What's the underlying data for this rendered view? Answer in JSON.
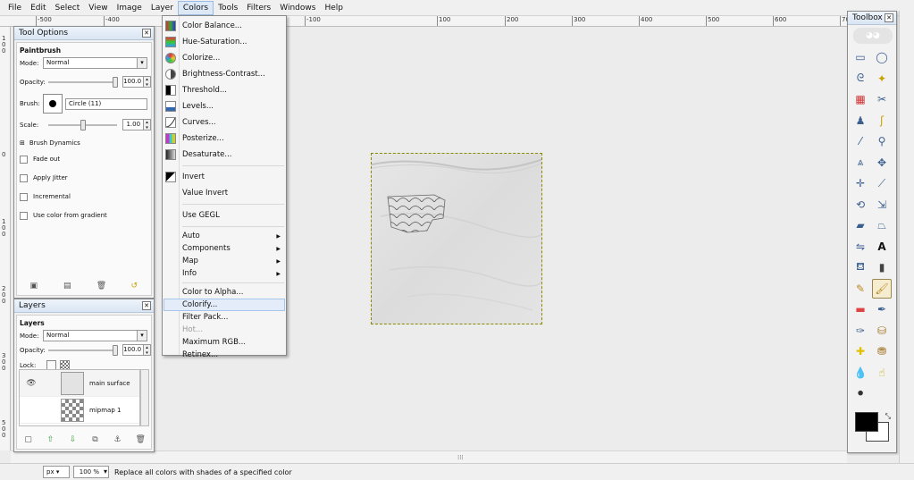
{
  "menubar": {
    "items": [
      "File",
      "Edit",
      "Select",
      "View",
      "Image",
      "Layer",
      "Colors",
      "Tools",
      "Filters",
      "Windows",
      "Help"
    ]
  },
  "ruler": {
    "h_labels": [
      "-500",
      "-400",
      "-100",
      "100",
      "200",
      "300",
      "400",
      "500",
      "600",
      "700"
    ],
    "v_labels": [
      "1 0 0",
      "0",
      "1 0 0",
      "2 0 0",
      "3 0 0",
      "5 0 0"
    ]
  },
  "colors_menu": {
    "items": [
      {
        "label": "Color Balance...",
        "icon": "color-balance-icon"
      },
      {
        "label": "Hue-Saturation...",
        "icon": "hue-saturation-icon"
      },
      {
        "label": "Colorize...",
        "icon": "colorize-icon"
      },
      {
        "label": "Brightness-Contrast...",
        "icon": "brightness-contrast-icon"
      },
      {
        "label": "Threshold...",
        "icon": "threshold-icon"
      },
      {
        "label": "Levels...",
        "icon": "levels-icon"
      },
      {
        "label": "Curves...",
        "icon": "curves-icon"
      },
      {
        "label": "Posterize...",
        "icon": "posterize-icon"
      },
      {
        "label": "Desaturate...",
        "icon": "desaturate-icon"
      },
      {
        "label": "Invert",
        "icon": "invert-icon"
      },
      {
        "label": "Value Invert"
      },
      {
        "label": "Use GEGL"
      },
      {
        "label": "Auto"
      },
      {
        "label": "Components"
      },
      {
        "label": "Map"
      },
      {
        "label": "Info"
      },
      {
        "label": "Color to Alpha..."
      },
      {
        "label": "Colorify..."
      },
      {
        "label": "Filter Pack..."
      },
      {
        "label": "Hot..."
      },
      {
        "label": "Maximum RGB..."
      },
      {
        "label": "Retinex..."
      }
    ]
  },
  "tool_options": {
    "title": "Tool Options",
    "section": "Paintbrush",
    "mode_label": "Mode:",
    "mode_value": "Normal",
    "opacity_label": "Opacity:",
    "opacity_value": "100.0",
    "opacity_level": 1.0,
    "brush_label": "Brush:",
    "brush_value": "Circle (11)",
    "scale_label": "Scale:",
    "scale_value": "1.00",
    "brush_dynamics": "Brush Dynamics",
    "checks": [
      "Fade out",
      "Apply Jitter",
      "Incremental",
      "Use color from gradient"
    ]
  },
  "layers": {
    "title": "Layers",
    "section": "Layers",
    "mode_label": "Mode:",
    "mode_value": "Normal",
    "opacity_label": "Opacity:",
    "opacity_value": "100.0",
    "lock_label": "Lock:",
    "rows": [
      {
        "name": "main surface",
        "visible": true
      },
      {
        "name": "mipmap 1",
        "visible": false
      }
    ]
  },
  "toolbox": {
    "title": "Toolbox"
  },
  "status": {
    "unit": "px",
    "zoom": "100 %",
    "message": "Replace all colors with shades of a specified color"
  }
}
